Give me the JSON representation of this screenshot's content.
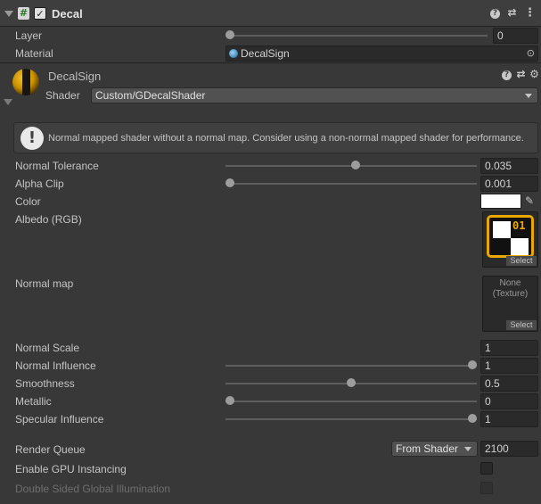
{
  "component": {
    "title": "Decal",
    "enabled_check": "✓",
    "hash_glyph": "#",
    "help_glyph": "?",
    "settings_glyph": "⇄",
    "menu_glyph": "⋮"
  },
  "layer": {
    "label": "Layer",
    "value": "0",
    "slider_fraction": 0.0
  },
  "material": {
    "label": "Material",
    "value": "DecalSign",
    "picker_glyph": "⊙"
  },
  "material_header": {
    "name": "DecalSign",
    "shader_label": "Shader",
    "shader_value": "Custom/GDecalShader",
    "help_glyph": "?",
    "settings_glyph": "⇄",
    "gear_glyph": "⚙"
  },
  "warning": {
    "icon_glyph": "!",
    "text": "Normal mapped shader without a normal map. Consider using a non-normal mapped shader for performance."
  },
  "properties": {
    "normal_tolerance": {
      "label": "Normal Tolerance",
      "value": "0.035",
      "slider_fraction": 0.52
    },
    "alpha_clip": {
      "label": "Alpha Clip",
      "value": "0.001",
      "slider_fraction": 0.0
    },
    "color": {
      "label": "Color",
      "swatch": "#ffffff",
      "eyedropper_glyph": "✎"
    },
    "albedo": {
      "label": "Albedo (RGB)",
      "select_label": "Select",
      "thumb_text": "01"
    },
    "normal_map": {
      "label": "Normal map",
      "none_line1": "None",
      "none_line2": "(Texture)",
      "select_label": "Select"
    },
    "normal_scale": {
      "label": "Normal Scale",
      "value": "1"
    },
    "normal_influence": {
      "label": "Normal Influence",
      "value": "1",
      "slider_fraction": 1.0
    },
    "smoothness": {
      "label": "Smoothness",
      "value": "0.5",
      "slider_fraction": 0.5
    },
    "metallic": {
      "label": "Metallic",
      "value": "0",
      "slider_fraction": 0.0
    },
    "specular_influence": {
      "label": "Specular Influence",
      "value": "1",
      "slider_fraction": 1.0
    }
  },
  "render_queue": {
    "label": "Render Queue",
    "dropdown": "From Shader",
    "value": "2100"
  },
  "gpu_instancing": {
    "label": "Enable GPU Instancing",
    "checked": false
  },
  "double_sided_gi": {
    "label": "Double Sided Global Illumination",
    "checked": false
  }
}
